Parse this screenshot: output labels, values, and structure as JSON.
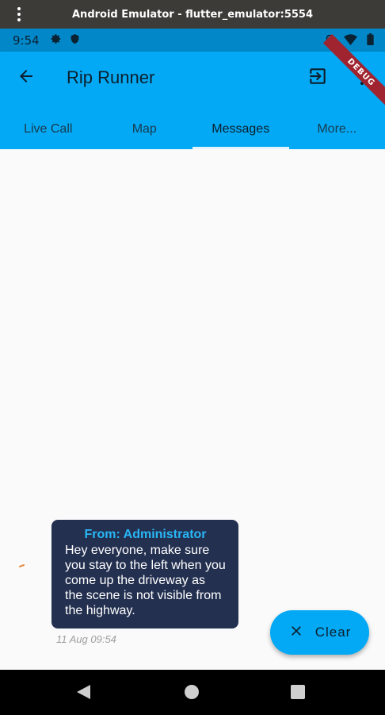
{
  "window": {
    "title": "Android Emulator - flutter_emulator:5554"
  },
  "status_bar": {
    "time": "9:54"
  },
  "debug_banner": "DEBUG",
  "app_bar": {
    "title": "Rip Runner"
  },
  "tabs": [
    {
      "label": "Live Call"
    },
    {
      "label": "Map"
    },
    {
      "label": "Messages",
      "active": true
    },
    {
      "label": "More..."
    }
  ],
  "message": {
    "from": "From: Administrator",
    "body": "Hey everyone, make sure you stay to the left when you come up the driveway as the scene is not visible from the highway.",
    "time": "11 Aug 09:54"
  },
  "fab": {
    "label": "Clear"
  },
  "colors": {
    "app_bar": "#03a9f4",
    "status_bar": "#0288c9",
    "bubble": "#233050",
    "bubble_from": "#29b6f6",
    "debug": "#a02430"
  },
  "icons": {
    "window_menu": "kebab-icon",
    "settings": "gear-icon",
    "shield": "shield-icon",
    "location": "location-icon",
    "wifi": "wifi-icon",
    "battery": "battery-icon",
    "back": "arrow-left-icon",
    "logout": "logout-icon",
    "overflow": "more-vert-icon",
    "clear": "close-icon",
    "nav_back": "triangle-back-icon",
    "nav_home": "circle-home-icon",
    "nav_recents": "square-recents-icon"
  }
}
